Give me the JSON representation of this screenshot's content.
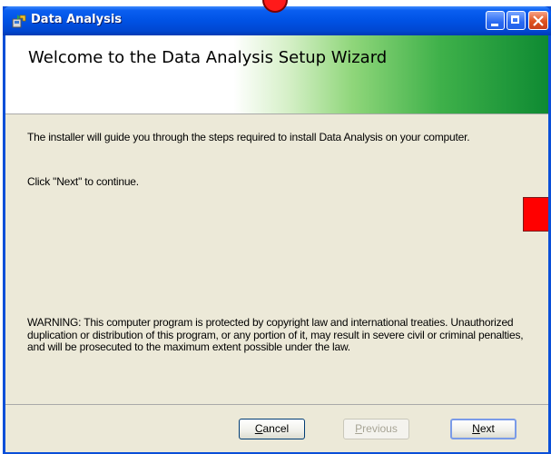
{
  "window": {
    "title": "Data Analysis",
    "controls": {
      "minimize": "minimize",
      "maximize": "maximize",
      "close": "close"
    }
  },
  "banner": {
    "title": "Welcome to the Data Analysis Setup Wizard"
  },
  "content": {
    "intro": "The installer will guide you through the steps required to install Data Analysis on your computer.",
    "continue": "Click \"Next\" to continue.",
    "warning": "WARNING: This computer program is protected by copyright law and international treaties. Unauthorized duplication or distribution of this program, or any portion of it, may result in severe civil or criminal penalties, and will be prosecuted to the maximum extent possible under the law."
  },
  "buttons": {
    "cancel": {
      "accel": "C",
      "rest": "ancel"
    },
    "previous": {
      "accel": "P",
      "rest": "revious"
    },
    "next": {
      "accel": "N",
      "rest": "ext"
    }
  },
  "colors": {
    "titlebar": "#0052e4",
    "banner_green": "#0e8a32",
    "marker_red": "#ff0000"
  }
}
